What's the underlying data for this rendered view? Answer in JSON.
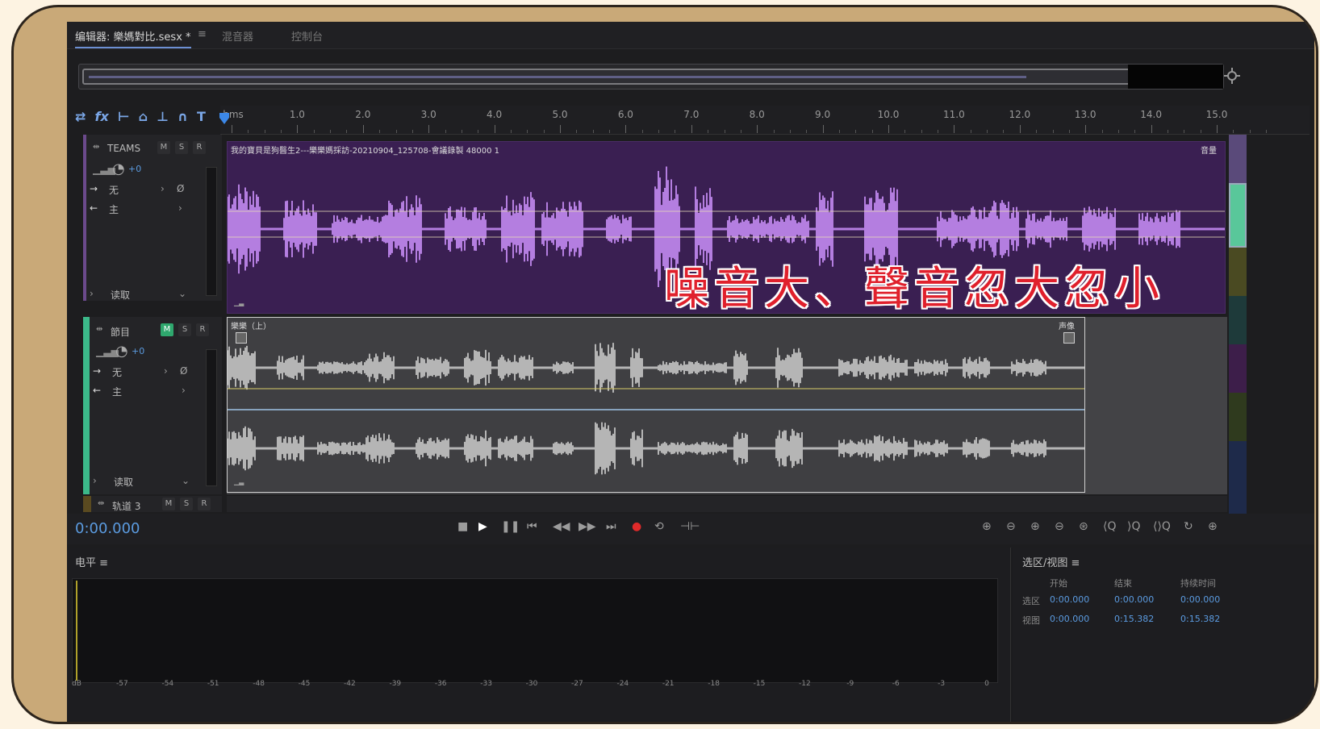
{
  "tabs": [
    {
      "label": "编辑器: 樂媽對比.sesx *"
    },
    {
      "label": "≡"
    },
    {
      "label": "混音器"
    },
    {
      "label": "控制台"
    }
  ],
  "toolbar": {
    "icons": [
      "sync-icon",
      "fx-icon",
      "input-icon",
      "lock-icon",
      "lock2-icon",
      "magnet-icon",
      "marker-icon"
    ],
    "fx_label": "fx"
  },
  "ruler": {
    "unit": "hms",
    "labels": [
      "1.0",
      "2.0",
      "3.0",
      "4.0",
      "5.0",
      "6.0",
      "7.0",
      "8.0",
      "9.0",
      "10.0",
      "11.0",
      "12.0",
      "13.0",
      "14.0",
      "15.0"
    ]
  },
  "tracks": [
    {
      "name": "TEAMS",
      "volume": "+0",
      "input": "无",
      "output": "主",
      "mode": "读取",
      "clip_title": "我的寶貝是狗醫生2---樂樂媽採訪-20210904_125708-會議錄製 48000 1",
      "clip_right": "音量"
    },
    {
      "name": "節目",
      "volume": "+0",
      "input": "无",
      "output": "主",
      "mode": "读取",
      "clip_title": "樂樂（上）",
      "clip_right": "声像"
    },
    {
      "name": "轨道 3"
    }
  ],
  "caption": "噪音大、聲音忽大忽小",
  "transport": {
    "timecode": "0:00.000"
  },
  "levels_panel": {
    "title": "电平 ≡",
    "db_scale": [
      "dB",
      "-57",
      "-54",
      "-51",
      "-48",
      "-45",
      "-42",
      "-39",
      "-36",
      "-33",
      "-30",
      "-27",
      "-24",
      "-21",
      "-18",
      "-15",
      "-12",
      "-9",
      "-6",
      "-3",
      "0"
    ]
  },
  "selection_panel": {
    "title": "选区/视图 ≡",
    "col_start": "开始",
    "col_end": "结束",
    "col_duration": "持续时间",
    "row_selection": "选区",
    "row_view": "视图",
    "sel_start": "0:00.000",
    "sel_end": "0:00.000",
    "sel_duration": "0:00.000",
    "view_start": "0:00.000",
    "view_end": "0:15.382",
    "view_duration": "0:15.382"
  },
  "colors": {
    "track1_clip": "#3a1f52",
    "track1_wave": "#b47ee0",
    "track2_wave": "#b5b5b5",
    "accent": "#5b9be0",
    "caption": "#e0202c"
  }
}
